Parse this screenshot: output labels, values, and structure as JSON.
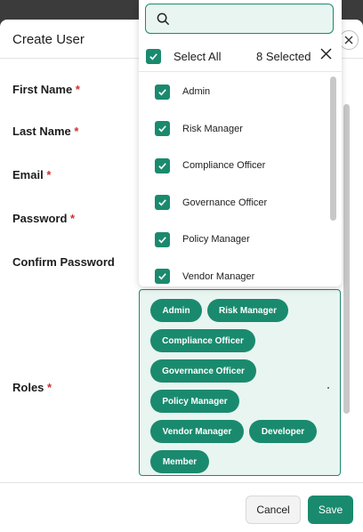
{
  "modal": {
    "title": "Create User",
    "fields": {
      "first_name": "First Name",
      "last_name": "Last Name",
      "email": "Email",
      "password": "Password",
      "confirm_password": "Confirm Password",
      "roles": "Roles"
    },
    "required_marker": "*"
  },
  "roles_dropdown": {
    "search_placeholder": "",
    "select_all_label": "Select All",
    "selected_count": "8 Selected",
    "select_all_checked": true,
    "options": [
      {
        "label": "Admin",
        "checked": true
      },
      {
        "label": "Risk Manager",
        "checked": true
      },
      {
        "label": "Compliance Officer",
        "checked": true
      },
      {
        "label": "Governance Officer",
        "checked": true
      },
      {
        "label": "Policy Manager",
        "checked": true
      },
      {
        "label": "Vendor Manager",
        "checked": true
      }
    ]
  },
  "selected_roles": [
    "Admin",
    "Risk Manager",
    "Compliance Officer",
    "Governance Officer",
    "Policy Manager",
    "Vendor Manager",
    "Developer",
    "Member"
  ],
  "footer": {
    "cancel_label": "Cancel",
    "save_label": "Save"
  },
  "colors": {
    "accent": "#1a8a6e",
    "accent_light": "#e9f5f1",
    "required": "#d32f2f"
  },
  "icons": {
    "close": "close-icon",
    "search": "search-icon",
    "check": "check-icon",
    "clear": "clear-selection-icon"
  }
}
